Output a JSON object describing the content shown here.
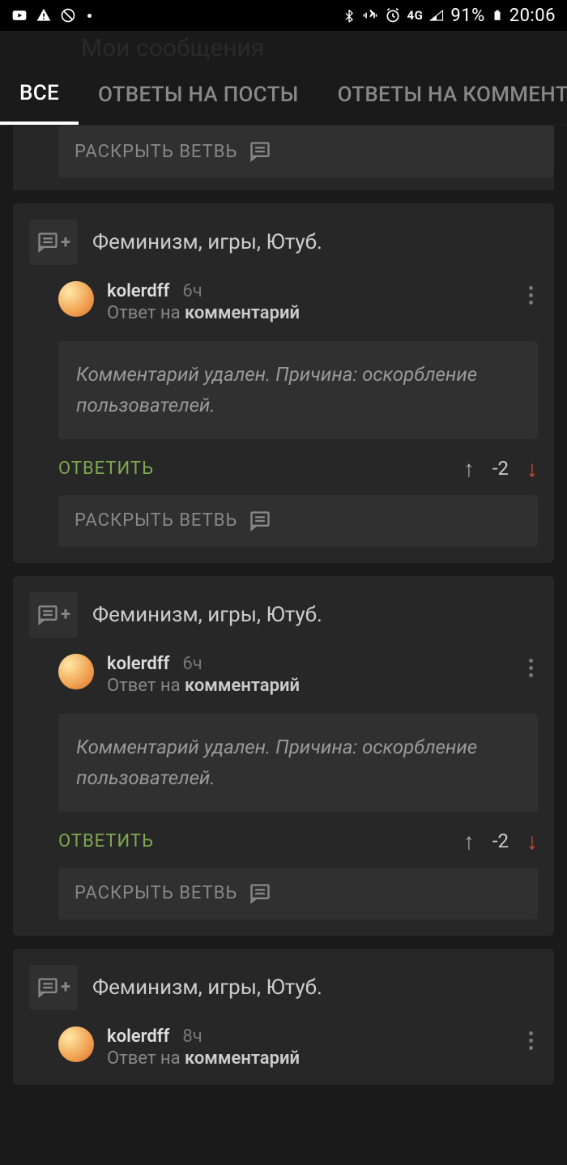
{
  "status": {
    "network": "4G",
    "battery": "91%",
    "time": "20:06"
  },
  "header": {
    "title": "Мои сообщения"
  },
  "tabs": {
    "all": "ВСЕ",
    "post_replies": "ОТВЕТЫ НА ПОСТЫ",
    "comment_replies": "ОТВЕТЫ НА КОММЕНТАР"
  },
  "labels": {
    "expand_branch": "РАСКРЫТЬ ВЕТВЬ",
    "reply": "ОТВЕТИТЬ",
    "reply_to_prefix": "Ответ на",
    "reply_to_target": "комментарий"
  },
  "cards": [
    {
      "title": "Феминизм, игры, Ютуб.",
      "username": "kolerdff",
      "time": "6ч",
      "body": "Комментарий удален. Причина: оскорбление пользователей.",
      "score": "-2"
    },
    {
      "title": "Феминизм, игры, Ютуб.",
      "username": "kolerdff",
      "time": "6ч",
      "body": "Комментарий удален. Причина: оскорбление пользователей.",
      "score": "-2"
    },
    {
      "title": "Феминизм, игры, Ютуб.",
      "username": "kolerdff",
      "time": "8ч"
    }
  ]
}
